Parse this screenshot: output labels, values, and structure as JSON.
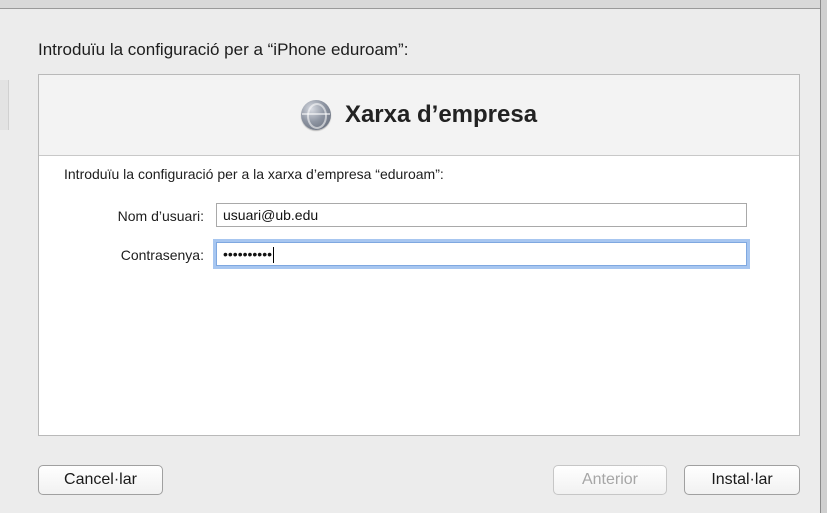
{
  "dialog": {
    "prompt": "Introduïu la configuració per a “iPhone eduroam”:"
  },
  "panel": {
    "title": "Xarxa d’empresa",
    "icon": "globe-network-icon",
    "subprompt": "Introduïu la configuració per a la xarxa d’empresa “eduroam”:",
    "username_label": "Nom d’usuari:",
    "username_value": "usuari@ub.edu",
    "password_label": "Contrasenya:",
    "password_value": "••••••••••"
  },
  "buttons": {
    "cancel": "Cancel·lar",
    "previous": "Anterior",
    "install": "Instal·lar"
  },
  "colors": {
    "focus_ring": "#a7c6f0",
    "background": "#ececec"
  }
}
